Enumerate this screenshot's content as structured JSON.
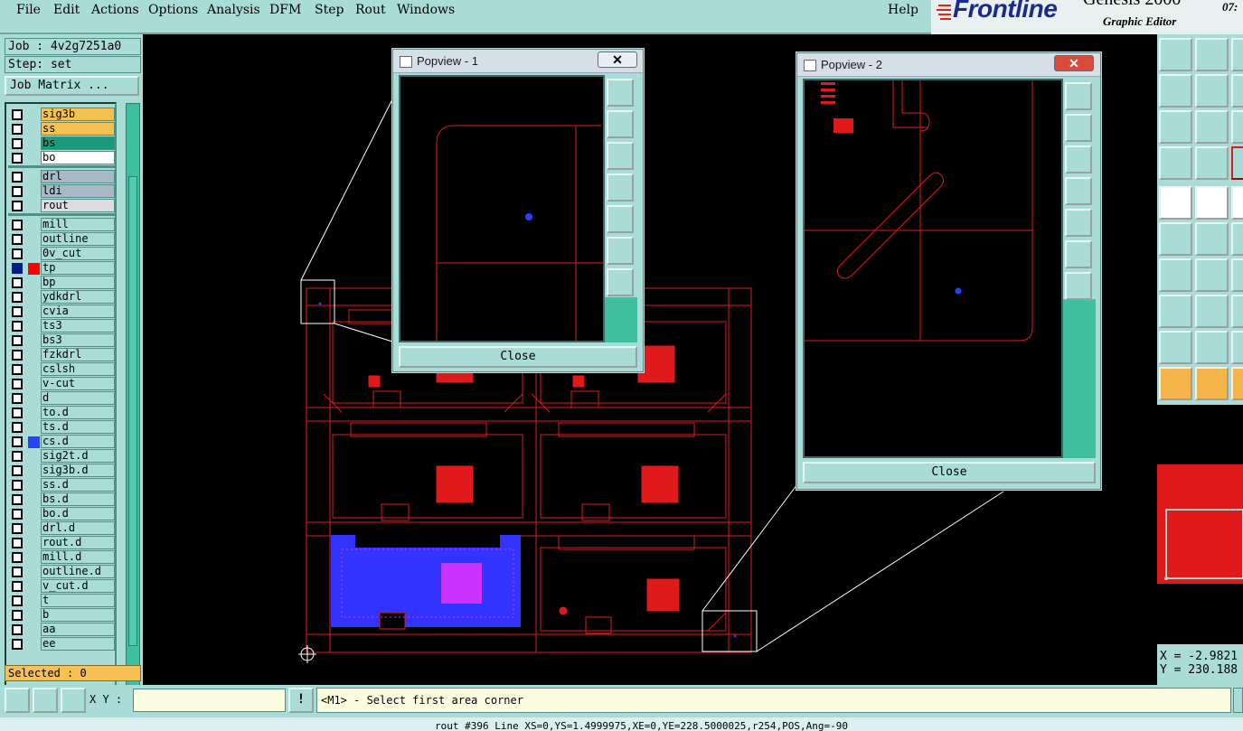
{
  "menu": {
    "items": [
      "File",
      "Edit",
      "Actions",
      "Options",
      "Analysis",
      "DFM",
      "Step",
      "Rout",
      "Windows"
    ],
    "help": "Help"
  },
  "brand": {
    "logo": "Frontline",
    "product": "Genesis 2000",
    "subtitle": "Graphic Editor",
    "time": "07:"
  },
  "left_panel": {
    "job": "Job : 4v2g7251a0",
    "step": "Step: set",
    "job_matrix_button": "Job Matrix ...",
    "selected": "Selected : 0",
    "layers": [
      {
        "name": "sig3b",
        "color": "#f5c150"
      },
      {
        "name": "ss",
        "color": "#f5c150"
      },
      {
        "name": "bs",
        "color": "#1a9a78"
      },
      {
        "name": "bo",
        "color": "#ffffff"
      },
      {
        "name": "drl",
        "color": "#a8b8c8"
      },
      {
        "name": "ldi",
        "color": "#a8b8c8"
      },
      {
        "name": "rout",
        "color": "#dddddd"
      },
      {
        "name": "mill",
        "color": "#a9dcd6"
      },
      {
        "name": "outline",
        "color": "#a9dcd6"
      },
      {
        "name": "0v_cut",
        "color": "#a9dcd6"
      },
      {
        "name": "tp",
        "color": "#a9dcd6",
        "display_color": "#ff0000",
        "work": true
      },
      {
        "name": "bp",
        "color": "#a9dcd6"
      },
      {
        "name": "ydkdrl",
        "color": "#a9dcd6"
      },
      {
        "name": "cvia",
        "color": "#a9dcd6"
      },
      {
        "name": "ts3",
        "color": "#a9dcd6"
      },
      {
        "name": "bs3",
        "color": "#a9dcd6"
      },
      {
        "name": "fzkdrl",
        "color": "#a9dcd6"
      },
      {
        "name": "cslsh",
        "color": "#a9dcd6"
      },
      {
        "name": "v-cut",
        "color": "#a9dcd6"
      },
      {
        "name": "d",
        "color": "#a9dcd6"
      },
      {
        "name": "to.d",
        "color": "#a9dcd6"
      },
      {
        "name": "ts.d",
        "color": "#a9dcd6"
      },
      {
        "name": "cs.d",
        "color": "#a9dcd6",
        "display_color": "#2244ff"
      },
      {
        "name": "sig2t.d",
        "color": "#a9dcd6"
      },
      {
        "name": "sig3b.d",
        "color": "#a9dcd6"
      },
      {
        "name": "ss.d",
        "color": "#a9dcd6"
      },
      {
        "name": "bs.d",
        "color": "#a9dcd6"
      },
      {
        "name": "bo.d",
        "color": "#a9dcd6"
      },
      {
        "name": "drl.d",
        "color": "#a9dcd6"
      },
      {
        "name": "rout.d",
        "color": "#a9dcd6"
      },
      {
        "name": "mill.d",
        "color": "#a9dcd6"
      },
      {
        "name": "outline.d",
        "color": "#a9dcd6"
      },
      {
        "name": "v_cut.d",
        "color": "#a9dcd6"
      },
      {
        "name": "t",
        "color": "#a9dcd6"
      },
      {
        "name": "b",
        "color": "#a9dcd6"
      },
      {
        "name": "aa",
        "color": "#a9dcd6"
      },
      {
        "name": "ee",
        "color": "#a9dcd6"
      }
    ]
  },
  "popview1": {
    "title": "Popview - 1",
    "close_label": "Close",
    "close_x": "✕"
  },
  "popview2": {
    "title": "Popview - 2",
    "close_label": "Close",
    "close_x": "✕"
  },
  "coords": {
    "x": "X = -2.9821",
    "y": "Y = 230.188"
  },
  "command": {
    "xy_label": "X Y :",
    "xy_value": "",
    "warn_icon": "!",
    "prompt": "<M1> - Select first area corner"
  },
  "status": "rout #396 Line XS=0,YS=1.4999975,XE=0,YE=228.5000025,r254,POS,Ang=-90",
  "colors": {
    "accent": "#a9dcd6",
    "layer_work": "#ff0000",
    "highlight": "#3333ff"
  }
}
